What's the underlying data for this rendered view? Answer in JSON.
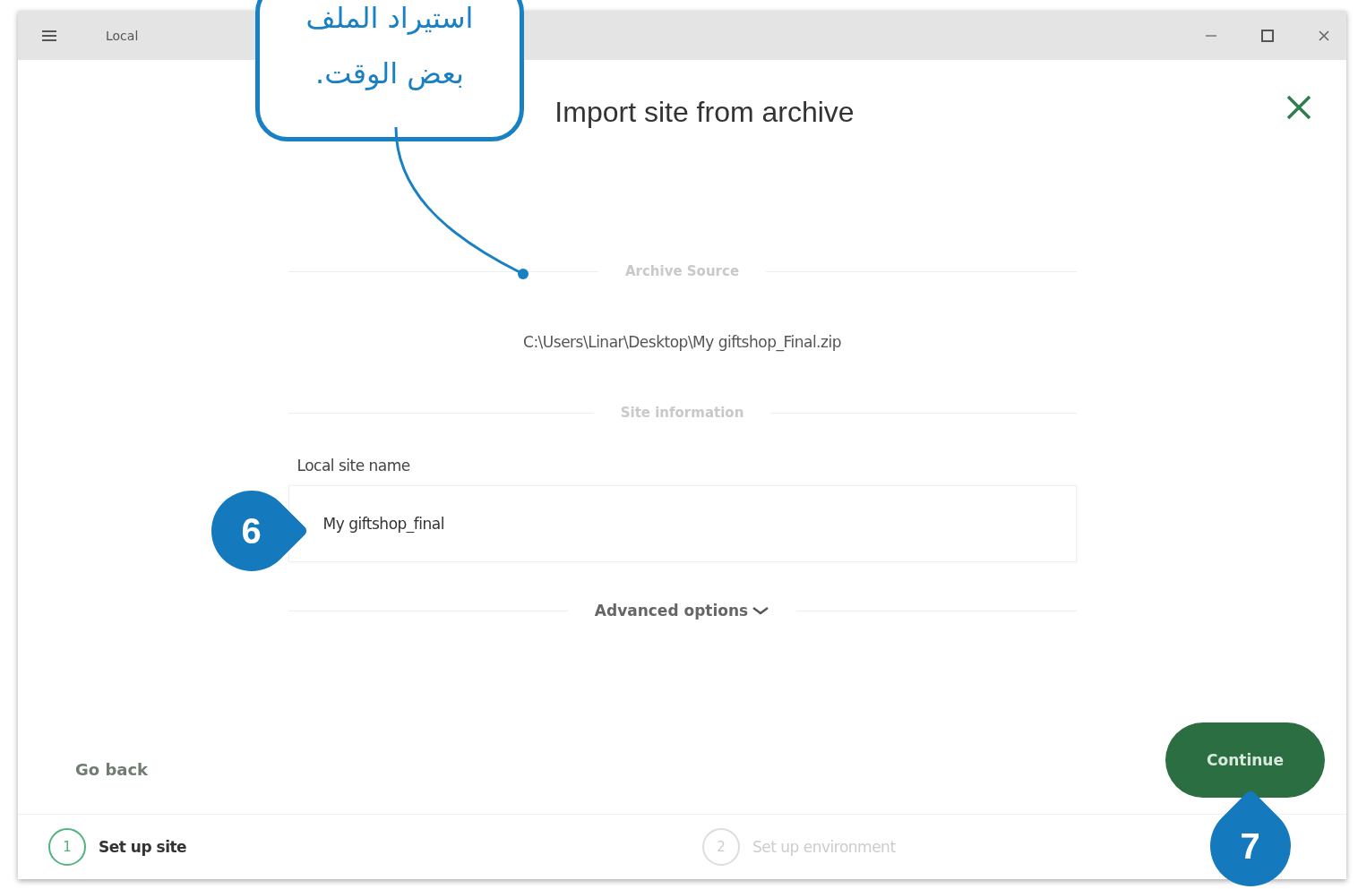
{
  "window": {
    "title": "Local"
  },
  "dialog": {
    "title": "Import site from archive",
    "archive_section": "Archive Source",
    "archive_path": "C:\\Users\\Linar\\Desktop\\My giftshop_Final.zip",
    "site_section": "Site information",
    "field": {
      "label": "Local site name",
      "value": "My giftshop_final"
    },
    "advanced": {
      "label": "Advanced options",
      "expanded": false
    }
  },
  "footer": {
    "back": "Go back",
    "continue": "Continue"
  },
  "steps": [
    {
      "number": "1",
      "label": "Set up site",
      "selected": true
    },
    {
      "number": "2",
      "label": "Set up environment",
      "selected": false
    }
  ],
  "callout": {
    "text": "استيراد الملف بعض الوقت."
  },
  "markers": [
    {
      "number": "6",
      "kind": "right"
    },
    {
      "number": "7",
      "kind": "up"
    }
  ]
}
